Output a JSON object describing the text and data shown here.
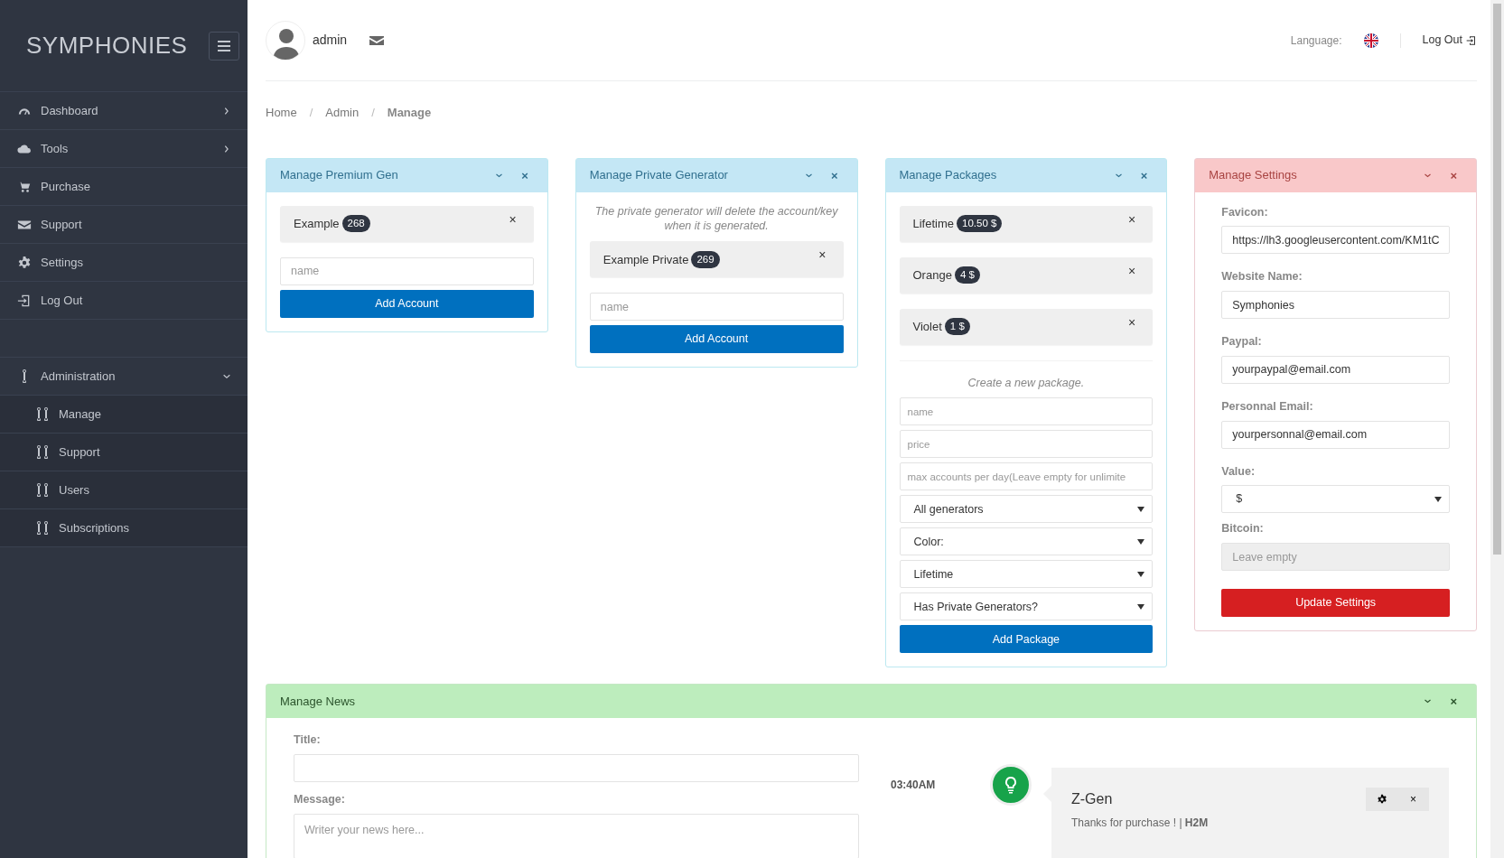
{
  "sidebar": {
    "brand": "SYMPHONIES",
    "items": [
      {
        "label": "Dashboard",
        "kind": "submenu",
        "expanded": false
      },
      {
        "label": "Tools",
        "kind": "submenu",
        "expanded": false
      },
      {
        "label": "Purchase",
        "kind": "link"
      },
      {
        "label": "Support",
        "kind": "link"
      },
      {
        "label": "Settings",
        "kind": "link"
      },
      {
        "label": "Log Out",
        "kind": "link"
      }
    ],
    "admin": {
      "label": "Administration",
      "kind": "submenu",
      "expanded": true,
      "children": [
        {
          "label": "Manage"
        },
        {
          "label": "Support"
        },
        {
          "label": "Users"
        },
        {
          "label": "Subscriptions"
        }
      ]
    }
  },
  "header": {
    "user": "admin",
    "language_label": "Language:",
    "logout": "Log Out"
  },
  "breadcrumb": [
    {
      "kind": "link",
      "text": "Home"
    },
    {
      "kind": "separator",
      "text": "/"
    },
    {
      "kind": "link",
      "text": "Admin"
    },
    {
      "kind": "separator",
      "text": "/"
    },
    {
      "kind": "current",
      "text": "Manage"
    }
  ],
  "premium": {
    "title": "Manage Premium Gen",
    "kind": "info",
    "close": "×",
    "accounts": [
      {
        "name": "Example",
        "count": "268",
        "remove": "×"
      }
    ],
    "placeholder": "name",
    "button": "Add Account"
  },
  "private": {
    "title": "Manage Private Generator",
    "kind": "info",
    "close": "×",
    "note": "The private generator will delete the account/key when it is generated.",
    "accounts": [
      {
        "name": "Example Private",
        "count": "269",
        "remove": "×"
      }
    ],
    "placeholder": "name",
    "button": "Add Account"
  },
  "packages": {
    "title": "Manage Packages",
    "kind": "info",
    "close": "×",
    "items": [
      {
        "name": "Lifetime",
        "price": "10.50 $",
        "remove": "×"
      },
      {
        "name": "Orange",
        "price": "4 $",
        "remove": "×"
      },
      {
        "name": "Violet",
        "price": "1 $",
        "remove": "×"
      }
    ],
    "note": "Create a new package.",
    "fields": [
      {
        "kind": "input",
        "placeholder": "name"
      },
      {
        "kind": "input",
        "placeholder": "price"
      },
      {
        "kind": "input",
        "placeholder": "max accounts per day(Leave empty for unlimite"
      },
      {
        "kind": "select",
        "value": "All generators"
      },
      {
        "kind": "select",
        "value": "Color:"
      },
      {
        "kind": "select",
        "value": "Lifetime"
      },
      {
        "kind": "select",
        "value": "Has Private Generators?"
      }
    ],
    "button": "Add Package"
  },
  "settings": {
    "title": "Manage Settings",
    "kind": "danger",
    "close": "×",
    "fields": [
      {
        "label": "Favicon:",
        "kind": "input",
        "value": "https://lh3.googleusercontent.com/KM1tC",
        "disabled": false
      },
      {
        "label": "Website Name:",
        "kind": "input",
        "value": "Symphonies",
        "disabled": false
      },
      {
        "label": "Paypal:",
        "kind": "input",
        "value": "yourpaypal@email.com",
        "disabled": false
      },
      {
        "label": "Personnal Email:",
        "kind": "input",
        "value": "yourpersonnal@email.com",
        "disabled": false
      },
      {
        "label": "Value:",
        "kind": "select",
        "value": "$",
        "disabled": false
      },
      {
        "label": "Bitcoin:",
        "kind": "input",
        "placeholder": "Leave empty",
        "disabled": true
      }
    ],
    "button": "Update Settings"
  },
  "news": {
    "title": "Manage News",
    "kind": "success",
    "close": "×",
    "title_label": "Title:",
    "message_label": "Message:",
    "message_placeholder": "Writer your news here...",
    "timeline": [
      {
        "time": "03:40AM",
        "heading": "Z-Gen",
        "close": "×",
        "text": "Thanks for purchase ! | **H2M**"
      }
    ]
  }
}
